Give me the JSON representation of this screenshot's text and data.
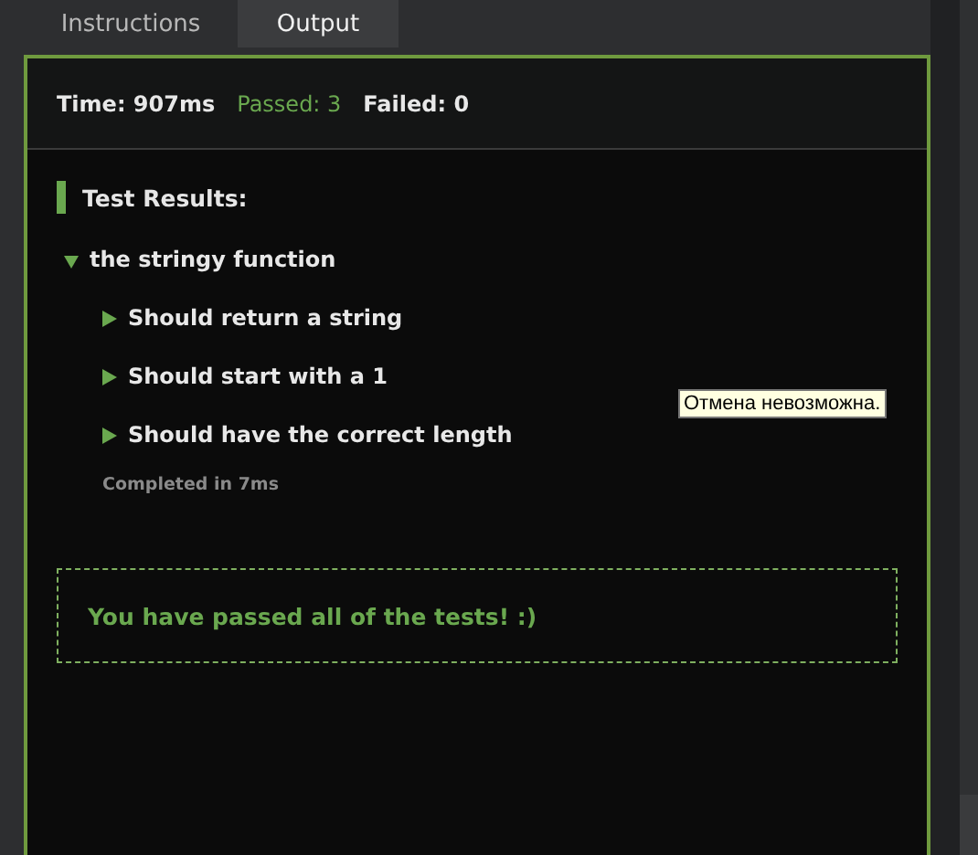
{
  "tabs": [
    {
      "label": "Instructions",
      "selected": false
    },
    {
      "label": "Output",
      "selected": true
    }
  ],
  "stats": {
    "time": "Time: 907ms",
    "passed": "Passed: 3",
    "failed": "Failed: 0"
  },
  "results": {
    "heading": "Test Results:",
    "suites": [
      {
        "label": "the stringy function",
        "expanded": true,
        "children": [
          {
            "label": "Should return a string",
            "expanded": false
          },
          {
            "label": "Should start with a 1",
            "expanded": false
          },
          {
            "label": "Should have the correct length",
            "expanded": false
          }
        ],
        "completed": "Completed in 7ms"
      }
    ]
  },
  "success_message": "You have passed all of the tests! :)",
  "tooltip": "Отмена невозможна."
}
